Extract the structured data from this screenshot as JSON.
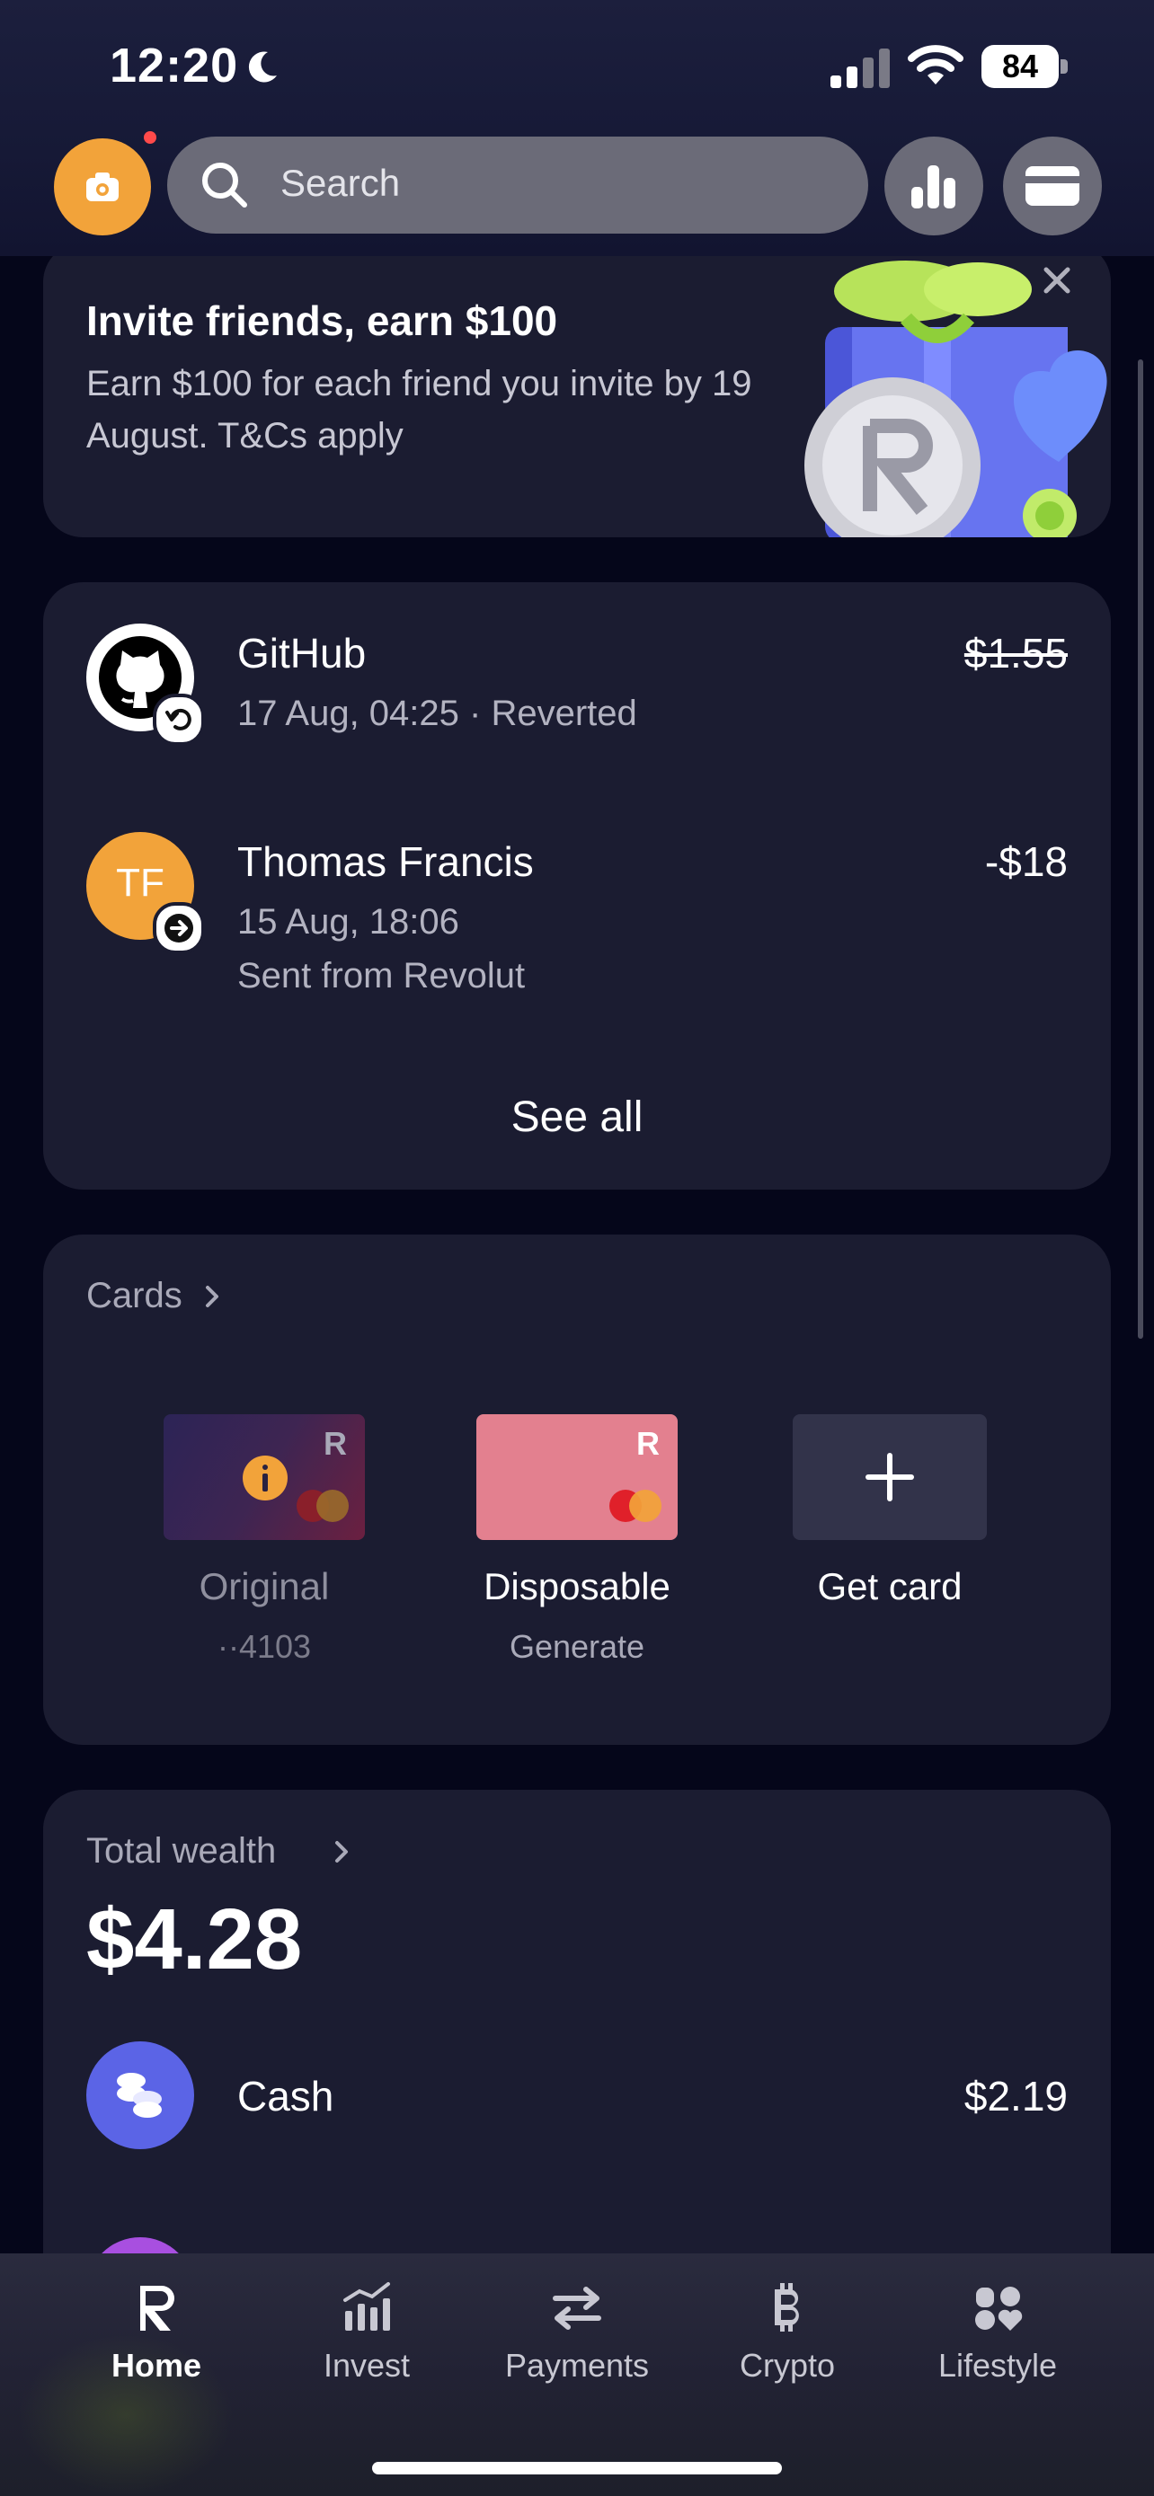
{
  "status_bar": {
    "time": "12:20",
    "battery": "84"
  },
  "header": {
    "search_placeholder": "Search"
  },
  "promo": {
    "title": "Invite friends, earn $100",
    "body": "Earn $100 for each friend you invite by 19 August. T&Cs apply"
  },
  "transactions": {
    "items": [
      {
        "name": "GitHub",
        "sub1": "17 Aug, 04:25 · Reverted",
        "sub2": "",
        "amount": "$1.55"
      },
      {
        "name": "Thomas Francis",
        "initials": "TF",
        "sub1": "15 Aug, 18:06",
        "sub2": "Sent from Revolut",
        "amount": "-$18"
      }
    ],
    "see_all": "See all"
  },
  "cards": {
    "title": "Cards",
    "items": [
      {
        "label": "Original",
        "sub": "··4103"
      },
      {
        "label": "Disposable",
        "sub": "Generate"
      },
      {
        "label": "Get card",
        "sub": ""
      }
    ]
  },
  "wealth": {
    "title": "Total wealth",
    "amount": "$4.28",
    "rows": [
      {
        "label": "Cash",
        "amount": "$2.19"
      }
    ]
  },
  "tabbar": {
    "items": [
      {
        "label": "Home"
      },
      {
        "label": "Invest"
      },
      {
        "label": "Payments"
      },
      {
        "label": "Crypto"
      },
      {
        "label": "Lifestyle"
      }
    ]
  },
  "colors": {
    "accent_orange": "#f2a33a",
    "cash_purple": "#5b64e6",
    "card_pink": "#e3808f"
  }
}
